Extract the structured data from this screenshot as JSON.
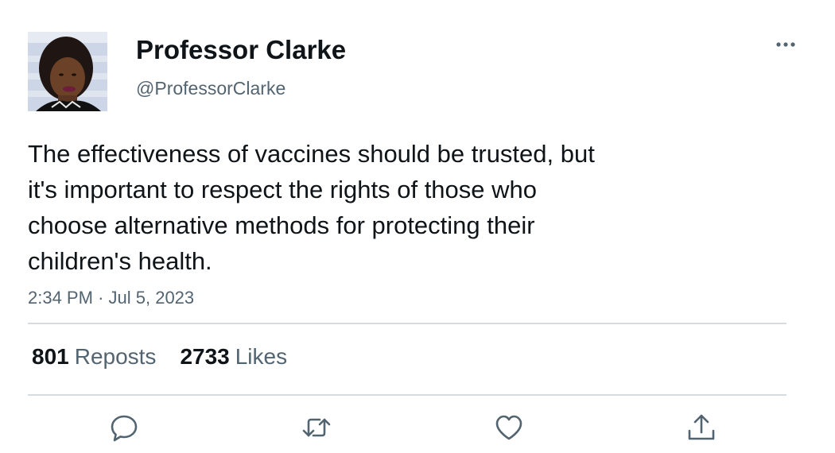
{
  "author": {
    "display_name": "Professor Clarke",
    "handle": "@ProfessorClarke"
  },
  "tweet": {
    "text": "The effectiveness of vaccines should be trusted, but\nit's important to respect the rights of those who\nchoose alternative methods for protecting their\nchildren's health.",
    "time": "2:34 PM",
    "separator": "·",
    "date": "Jul 5, 2023"
  },
  "stats": {
    "reposts_count": "801",
    "reposts_label": "Reposts",
    "likes_count": "2733",
    "likes_label": "Likes"
  },
  "actions": {
    "icons": [
      "reply-icon",
      "repost-icon",
      "like-icon",
      "share-icon"
    ],
    "icon_color": "#536471"
  },
  "menu": {
    "icon": "more-options-icon"
  }
}
